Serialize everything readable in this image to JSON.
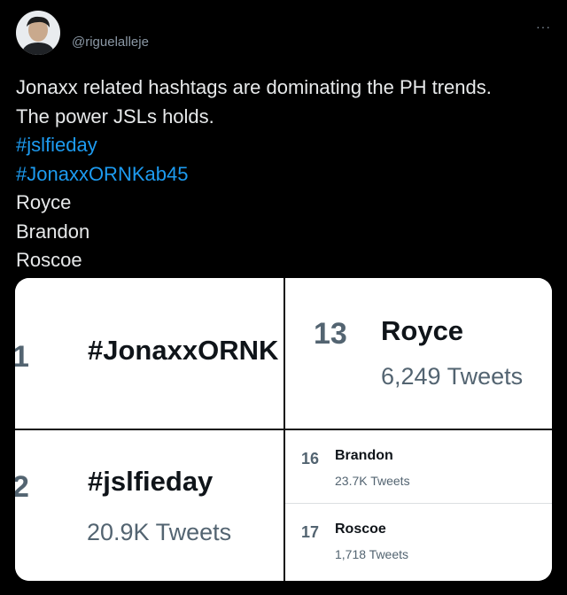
{
  "tweet": {
    "handle": "@riguelalleje",
    "more_icon": "···",
    "lines": [
      "Jonaxx related hashtags are dominating the PH trends.",
      "The power JSLs holds.",
      "#jslfieday",
      "#JonaxxORNKab45",
      "Royce",
      "Brandon",
      "Roscoe"
    ]
  },
  "trends": {
    "left": [
      {
        "rank": "1",
        "name": "#JonaxxORNK"
      },
      {
        "rank": "2",
        "name": "#jslfieday",
        "count": "20.9K Tweets"
      }
    ],
    "right_top": {
      "rank": "13",
      "name": "Royce",
      "count": "6,249 Tweets"
    },
    "right_bottom": [
      {
        "rank": "16",
        "name": "Brandon",
        "count": "23.7K Tweets"
      },
      {
        "rank": "17",
        "name": "Roscoe",
        "count": "1,718 Tweets"
      }
    ]
  },
  "colors": {
    "background": "#000000",
    "text": "#e7e9ea",
    "link": "#1d9bf0",
    "muted": "#8b98a5"
  }
}
